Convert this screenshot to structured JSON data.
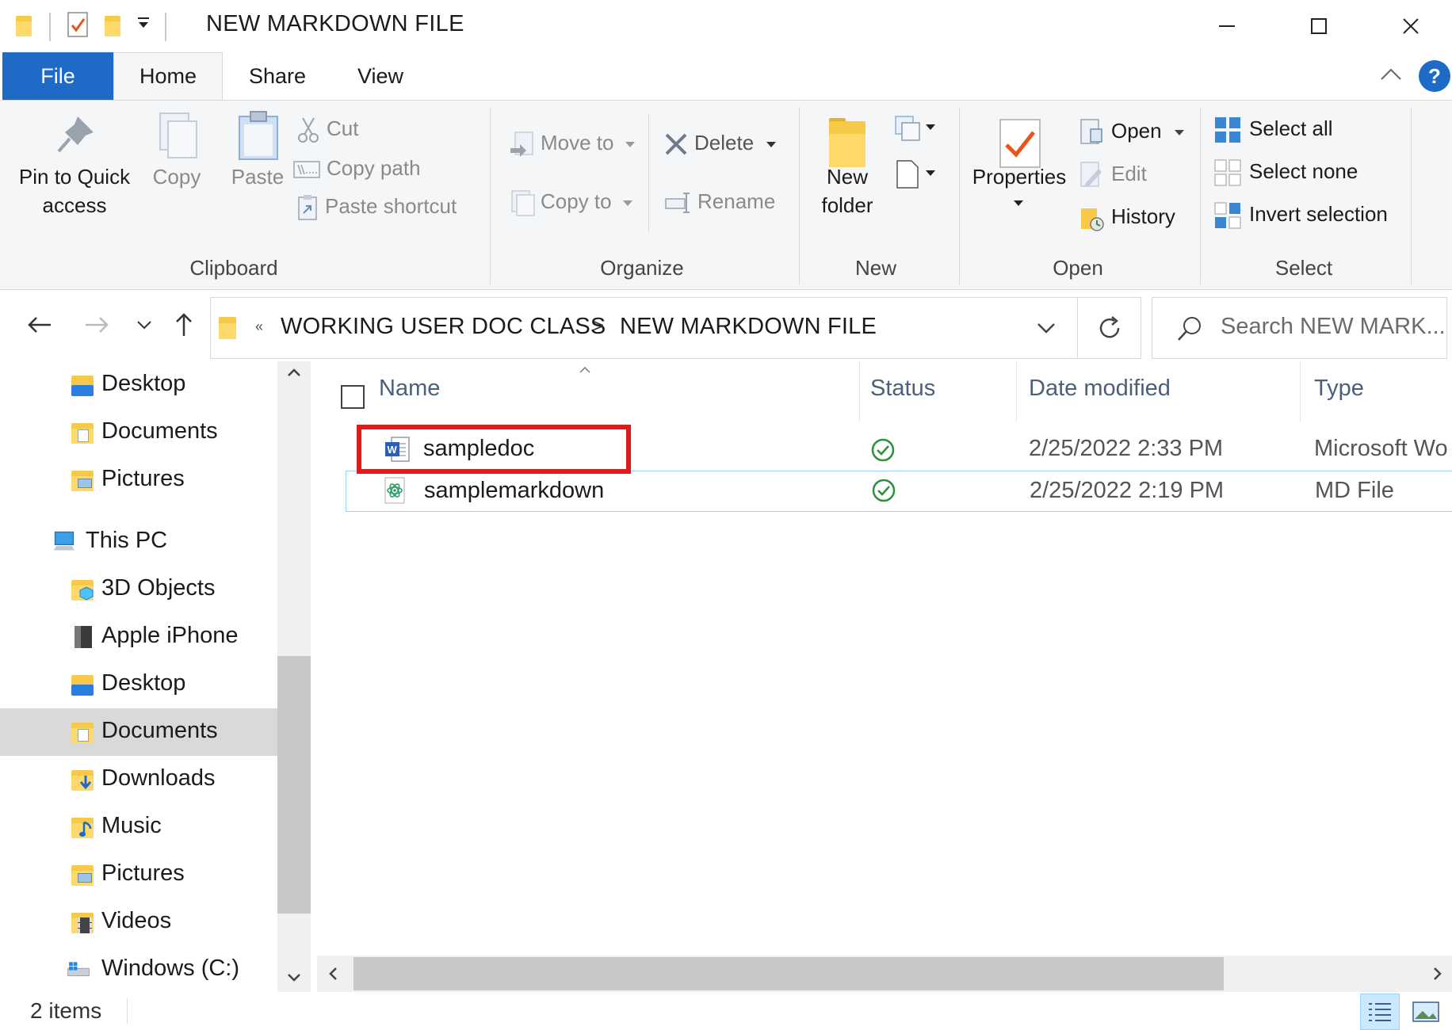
{
  "window": {
    "title": "NEW MARKDOWN FILE",
    "minimize_icon": "minimize-icon",
    "maximize_icon": "maximize-icon",
    "close_icon": "close-icon",
    "accent_color": "#1f6ac7"
  },
  "ribbon_tabs": {
    "file": "File",
    "home": "Home",
    "share": "Share",
    "view": "View",
    "help": "?"
  },
  "ribbon": {
    "clipboard": {
      "label": "Clipboard",
      "pin_line1": "Pin to Quick",
      "pin_line2": "access",
      "copy": "Copy",
      "paste": "Paste",
      "cut": "Cut",
      "copy_path": "Copy path",
      "paste_shortcut": "Paste shortcut"
    },
    "organize": {
      "label": "Organize",
      "move_to": "Move to",
      "copy_to": "Copy to",
      "delete": "Delete",
      "rename": "Rename"
    },
    "new": {
      "label": "New",
      "new_folder_line1": "New",
      "new_folder_line2": "folder"
    },
    "open": {
      "label": "Open",
      "properties": "Properties",
      "open": "Open",
      "edit": "Edit",
      "history": "History"
    },
    "select": {
      "label": "Select",
      "select_all": "Select all",
      "select_none": "Select none",
      "invert_selection": "Invert selection"
    }
  },
  "address": {
    "overflow": "«",
    "crumb1": "WORKING USER DOC CLASS",
    "separator": ">",
    "crumb2": "NEW MARKDOWN FILE",
    "search_placeholder": "Search NEW MARK..."
  },
  "nav_pane": {
    "items": [
      {
        "label": "Desktop"
      },
      {
        "label": "Documents"
      },
      {
        "label": "Pictures"
      },
      {
        "label": "This PC"
      },
      {
        "label": "3D Objects"
      },
      {
        "label": "Apple iPhone"
      },
      {
        "label": "Desktop"
      },
      {
        "label": "Documents"
      },
      {
        "label": "Downloads"
      },
      {
        "label": "Music"
      },
      {
        "label": "Pictures"
      },
      {
        "label": "Videos"
      },
      {
        "label": "Windows (C:)"
      }
    ],
    "selected": "Documents"
  },
  "file_list": {
    "columns": {
      "name": "Name",
      "status": "Status",
      "date_modified": "Date modified",
      "type": "Type"
    },
    "rows": [
      {
        "name": "sampledoc",
        "status": "synced",
        "date": "2/25/2022 2:33 PM",
        "type": "Microsoft Wo",
        "icon": "word-doc-icon"
      },
      {
        "name": "samplemarkdown",
        "status": "synced",
        "date": "2/25/2022 2:19 PM",
        "type": "MD File",
        "icon": "atom-file-icon"
      }
    ],
    "highlight_color": "#e01919"
  },
  "status_bar": {
    "item_count": "2 items"
  }
}
